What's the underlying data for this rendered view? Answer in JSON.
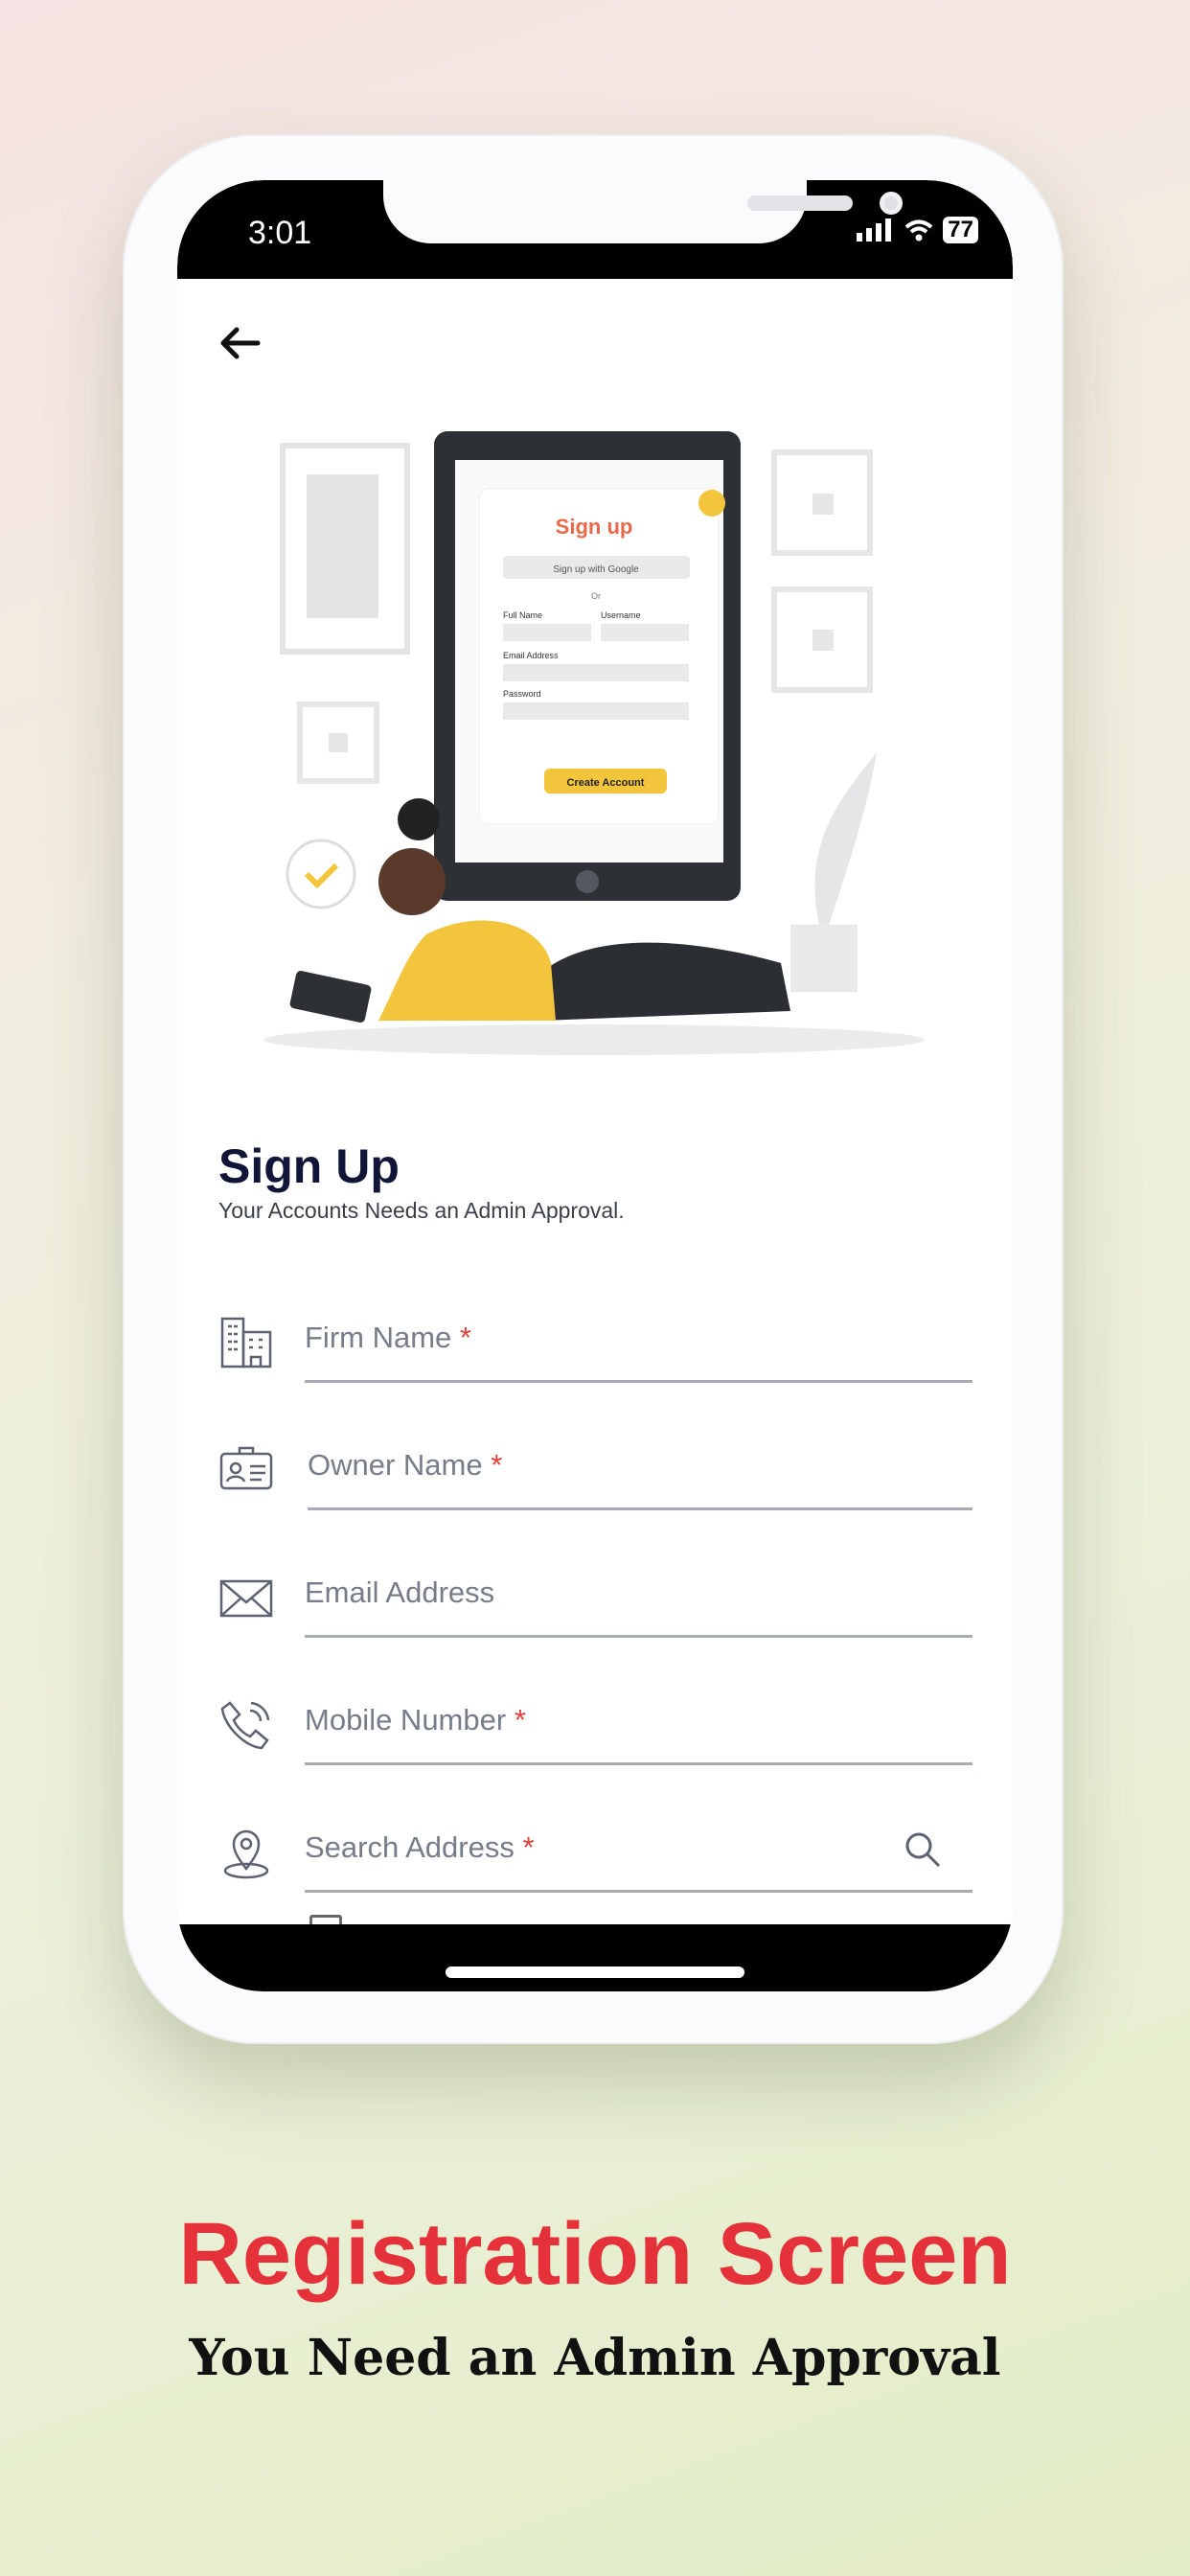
{
  "status_bar": {
    "time": "3:01",
    "battery": "77"
  },
  "illustration": {
    "card_title": "Sign up",
    "google": "Sign up with Google",
    "or": "Or",
    "full_name": "Full Name",
    "username": "Username",
    "email": "Email Address",
    "password": "Password",
    "button": "Create Account"
  },
  "page": {
    "title": "Sign Up",
    "subtitle": "Your Accounts Needs an Admin Approval."
  },
  "fields": [
    {
      "label": "Firm Name",
      "required": "*",
      "icon": "building-icon"
    },
    {
      "label": "Owner Name",
      "required": "*",
      "icon": "id-card-icon"
    },
    {
      "label": "Email Address",
      "required": "",
      "icon": "envelope-icon"
    },
    {
      "label": "Mobile Number",
      "required": "*",
      "icon": "phone-icon"
    },
    {
      "label": "Search Address",
      "required": "*",
      "icon": "location-pin-icon"
    }
  ],
  "caption": {
    "title": "Registration Screen",
    "subtitle": "You Need an Admin Approval"
  },
  "colors": {
    "accent": "#e5313a",
    "title": "#111638",
    "illustration_yellow": "#f2c53d"
  }
}
